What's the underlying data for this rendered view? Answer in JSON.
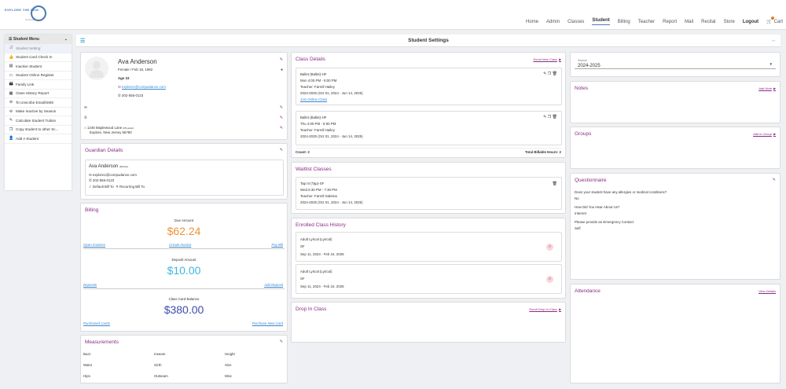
{
  "brand": {
    "line1": "EXPLORE THE NEW",
    "line2": "compudance"
  },
  "nav": [
    "Home",
    "Admin",
    "Classes",
    "Student",
    "Billing",
    "Teacher",
    "Report",
    "Mail",
    "Recital",
    "Store",
    "Logout",
    "Cart"
  ],
  "sidebar": {
    "title": "Student Menu",
    "items": [
      {
        "label": "Student Setting",
        "icon": "list-icon"
      },
      {
        "label": "Student Card Check In",
        "icon": "thumbs-up-icon"
      },
      {
        "label": "Inactive Student",
        "icon": "id-card-icon"
      },
      {
        "label": "Student Online Register",
        "icon": "monitor-icon"
      },
      {
        "label": "Family Link",
        "icon": "family-icon"
      },
      {
        "label": "Class History Report",
        "icon": "table-icon"
      },
      {
        "label": "To Unscribe Email/SMS",
        "icon": "ban-icon"
      },
      {
        "label": "Make Inactive by Season",
        "icon": "minus-circle-icon"
      },
      {
        "label": "Calculate Student Tuition",
        "icon": "edit-icon"
      },
      {
        "label": "Copy student to other Sc...",
        "icon": "copy-icon"
      },
      {
        "label": "Add A Student",
        "icon": "add-user-icon"
      }
    ]
  },
  "page_title": "Student Settings",
  "student": {
    "name": "Ava Anderson",
    "gender_dob": "Female / Feb 18, 1992",
    "age": "Age 33",
    "email": "explore1@compudance.com",
    "phone": "202-555-0123",
    "address1": "1245 Maplewood Lane",
    "address_tag": "(Physical)",
    "address2": "Explore, New Jersey 56780"
  },
  "guardian": {
    "title": "Guardian Details",
    "name": "Ava Anderson",
    "relation": "(Mother)",
    "email": "explore1@compudance.com",
    "phone": "202-555-0123",
    "default_bill": "Default Bill To",
    "recurring_bill": "Recurring Bill To"
  },
  "billing": {
    "title": "Billing",
    "due_label": "Due Amount",
    "due_value": "$62.24",
    "open_invoices": "Open Invoices",
    "create_invoice": "Create Invoice",
    "pay_bill": "Pay Bill",
    "deposit_label": "Deposit Amount",
    "deposit_value": "$10.00",
    "deposits": "Deposits",
    "add_deposit": "Add Deposit",
    "card_label": "Class Card Balance",
    "card_value": "$380.00",
    "purchased_cards": "Purchased Cards",
    "purchase_new_card": "Purchase New Card"
  },
  "measurements": {
    "title": "Measurements",
    "items": [
      "Bust",
      "Inseam",
      "Height",
      "Waist",
      "Girth",
      "Size",
      "Hips",
      "Outseam",
      "Misc"
    ]
  },
  "class_details": {
    "title": "Class Details",
    "link": "Enroll New Class",
    "classes": [
      {
        "name": "Ballet (Ballet)-HF",
        "time": "Mon 4:00 PM - 5:00 PM",
        "teacher": "Teacher: Farrell Hailey",
        "season": "2024-2025 (Oct 01, 2024 - Jun 14, 2025)",
        "join": "Join Online Class"
      },
      {
        "name": "Ballet (Ballet)-HF",
        "time": "Thu 4:00 PM - 5:00 PM",
        "teacher": "Teacher: Farrell Hailey",
        "season": "2024-2025 (Oct 01, 2024 - Jun 14, 2025)"
      }
    ],
    "count": "Count: 2",
    "hours": "Total Billable Hours: 2"
  },
  "waitlist": {
    "title": "Waitlist Classes",
    "name": "Tap III (Tap)-SF",
    "time": "Wed 6:30 PM - 7:30 PM",
    "teacher": "Teacher: Farrell Sabrina",
    "season": "2024-2025 (Oct 01, 2024 - Jun 14, 2025)"
  },
  "enrolled_history": {
    "title": "Enrolled Class History",
    "items": [
      {
        "name": "Adult Lyrical (Lyrical)",
        "code": "SF",
        "dates": "Sep 11, 2024 - Feb 24, 2025"
      },
      {
        "name": "Adult Lyrical (Lyrical)",
        "code": "SF",
        "dates": "Sep 11, 2024 - Feb 24, 2025"
      }
    ]
  },
  "drop_in": {
    "title": "Drop In Class",
    "link": "Enroll Drop In Class"
  },
  "season": {
    "label": "Season",
    "value": "2024-2025"
  },
  "notes": {
    "title": "Notes",
    "link": "Add Note"
  },
  "groups": {
    "title": "Groups",
    "link": "Add to Group"
  },
  "questionnaire": {
    "title": "Questionnaire",
    "items": [
      {
        "q": "Does your student have any allergies or medical conditions?",
        "a": "No"
      },
      {
        "q": "How Did You Hear About Us?",
        "a": "Internet"
      },
      {
        "q": "Please provide an Emergency Contact",
        "a": "Self"
      }
    ]
  },
  "attendance": {
    "title": "Attendance",
    "link": "View Details"
  },
  "colors": {
    "accent": "#8b2c84",
    "due": "#f0913a",
    "deposit": "#3fb7e0",
    "card": "#3b4db0"
  }
}
